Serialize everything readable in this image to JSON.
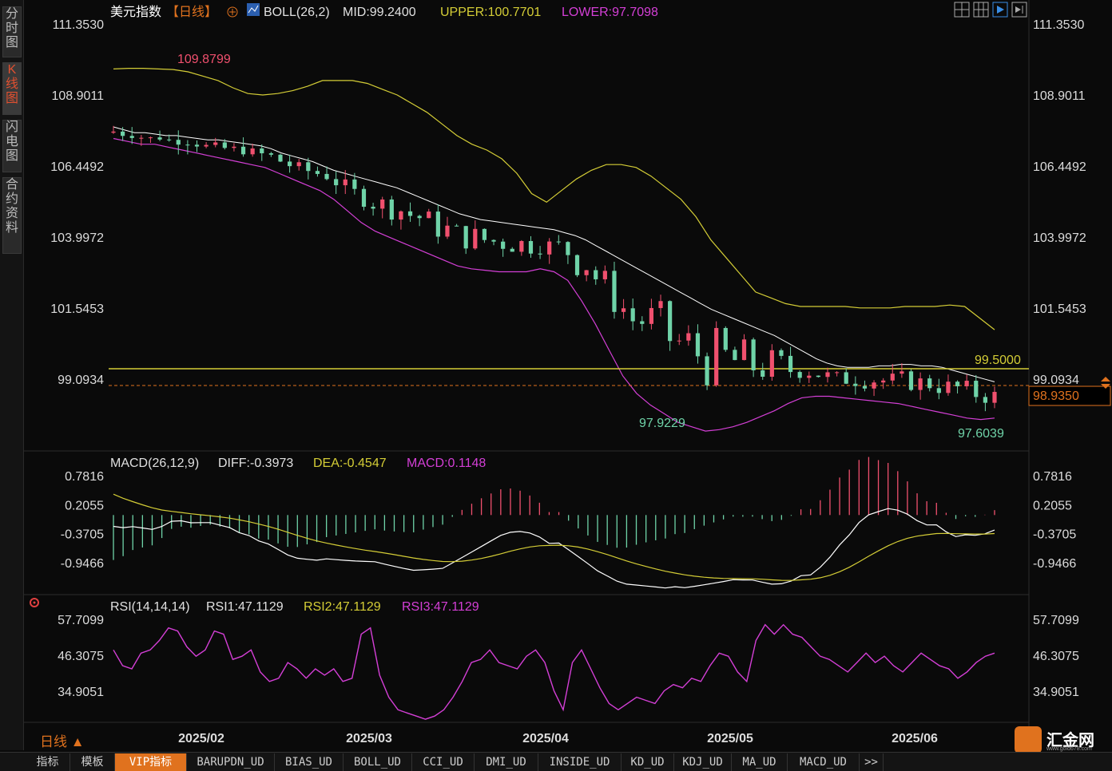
{
  "side_tabs": [
    {
      "label": "分时图",
      "active": false
    },
    {
      "label": "K线图",
      "active": true
    },
    {
      "label": "闪电图",
      "active": false
    },
    {
      "label": "合约资料",
      "active": false
    }
  ],
  "header": {
    "symbol": "美元指数",
    "period_tag": "【日线】",
    "boll": "BOLL(26,2)",
    "mid": "MID:99.2400",
    "upper": "UPPER:100.7701",
    "lower": "LOWER:97.7098"
  },
  "price_axis": [
    "111.3530",
    "108.9011",
    "106.4492",
    "103.9972",
    "101.5453",
    "99.0934"
  ],
  "annotations": {
    "high": "109.8799",
    "low1": "97.9229",
    "low2": "97.6039",
    "hline": "99.5000",
    "current": "98.9350"
  },
  "macd": {
    "title": "MACD(26,12,9)",
    "diff": "DIFF:-0.3973",
    "dea": "DEA:-0.4547",
    "macd": "MACD:0.1148",
    "axis": [
      "0.7816",
      "0.2055",
      "-0.3705",
      "-0.9466"
    ]
  },
  "rsi": {
    "title": "RSI(14,14,14)",
    "rsi1": "RSI1:47.1129",
    "rsi2": "RSI2:47.1129",
    "rsi3": "RSI3:47.1129",
    "axis": [
      "57.7099",
      "46.3075",
      "34.9051"
    ]
  },
  "x_axis": [
    "2025/02",
    "2025/03",
    "2025/04",
    "2025/05",
    "2025/06"
  ],
  "timeframe": "日线",
  "bottom_tabs": [
    "指标",
    "模板",
    "VIP指标",
    "BARUPDN_UD",
    "BIAS_UD",
    "BOLL_UD",
    "CCI_UD",
    "DMI_UD",
    "INSIDE_UD",
    "KD_UD",
    "KDJ_UD",
    "MA_UD",
    "MACD_UD",
    ">>"
  ],
  "logo": {
    "name": "汇金网",
    "url": "www.gold678.com"
  },
  "colors": {
    "up": "#f0506e",
    "down": "#6fd3a8",
    "mid": "#ffffff",
    "upper": "#d4cd36",
    "lower": "#d43fd6",
    "hline": "#d4cd36"
  },
  "chart_data": {
    "type": "candlestick",
    "title": "美元指数",
    "ylim": [
      97.2,
      111.6
    ],
    "start": [
      107.6,
      107.8
    ],
    "series": [
      {
        "name": "MID",
        "values": [
          107.8,
          107.7,
          107.6,
          107.6,
          107.55,
          107.5,
          107.5,
          107.45,
          107.4,
          107.35,
          107.35,
          107.3,
          107.25,
          107.2,
          107.15,
          107.05,
          106.9,
          106.8,
          106.7,
          106.6,
          106.45,
          106.3,
          106.2,
          106.1,
          106.0,
          105.9,
          105.8,
          105.7,
          105.55,
          105.4,
          105.25,
          105.1,
          104.95,
          104.8,
          104.7,
          104.6,
          104.55,
          104.5,
          104.45,
          104.4,
          104.35,
          104.3,
          104.25,
          104.15,
          104.05,
          103.9,
          103.7,
          103.5,
          103.3,
          103.1,
          102.9,
          102.7,
          102.5,
          102.3,
          102.1,
          101.9,
          101.7,
          101.5,
          101.35,
          101.2,
          101.05,
          100.9,
          100.75,
          100.6,
          100.4,
          100.2,
          100.0,
          99.8,
          99.65,
          99.55,
          99.5,
          99.5,
          99.5,
          99.55,
          99.55,
          99.6,
          99.6,
          99.55,
          99.55,
          99.5,
          99.4,
          99.3,
          99.2,
          99.1,
          99.0
        ]
      },
      {
        "name": "UPPER",
        "values": [
          109.8,
          109.82,
          109.82,
          109.8,
          109.78,
          109.7,
          109.55,
          109.4,
          109.15,
          108.95,
          108.9,
          108.95,
          109.05,
          109.2,
          109.4,
          109.4,
          109.4,
          109.3,
          109.1,
          108.9,
          108.6,
          108.3,
          107.9,
          107.5,
          107.2,
          107.0,
          106.7,
          106.2,
          105.5,
          105.2,
          105.6,
          106.0,
          106.3,
          106.5,
          106.5,
          106.4,
          106.1,
          105.7,
          105.3,
          104.7,
          103.9,
          103.3,
          102.7,
          102.1,
          101.9,
          101.7,
          101.6,
          101.6,
          101.6,
          101.6,
          101.55,
          101.55,
          101.55,
          101.6,
          101.6,
          101.6,
          101.65,
          101.6,
          101.2,
          100.8
        ]
      },
      {
        "name": "LOWER",
        "values": [
          107.4,
          107.3,
          107.2,
          107.2,
          107.1,
          107.0,
          106.9,
          106.8,
          106.7,
          106.6,
          106.5,
          106.4,
          106.2,
          106.0,
          105.8,
          105.6,
          105.3,
          104.9,
          104.5,
          104.2,
          104.0,
          103.8,
          103.6,
          103.4,
          103.2,
          103.0,
          102.9,
          102.85,
          102.8,
          102.8,
          102.8,
          102.9,
          102.8,
          102.5,
          101.8,
          101.0,
          100.1,
          99.2,
          98.6,
          98.2,
          97.9,
          97.6,
          97.45,
          97.3,
          97.35,
          97.45,
          97.6,
          97.8,
          98.0,
          98.25,
          98.45,
          98.5,
          98.5,
          98.45,
          98.4,
          98.35,
          98.3,
          98.25,
          98.15,
          98.05,
          97.95,
          97.85,
          97.75,
          97.7,
          97.75
        ]
      },
      {
        "name": "RSI",
        "values": [
          48,
          43,
          42,
          47,
          48,
          51,
          55,
          54,
          49,
          46,
          48,
          54,
          53,
          45,
          46,
          48,
          41,
          38,
          39,
          44,
          42,
          39,
          42,
          40,
          42,
          38,
          39,
          53,
          55,
          40,
          33,
          29,
          28,
          27,
          26,
          27,
          29,
          33,
          38,
          44,
          45,
          48,
          44,
          43,
          42,
          46,
          48,
          44,
          35,
          29,
          44,
          48,
          42,
          36,
          31,
          29,
          31,
          33,
          32,
          31,
          35,
          37,
          36,
          39,
          38,
          43,
          47,
          46,
          41,
          38,
          51,
          56,
          53,
          56,
          53,
          52,
          49,
          46,
          45,
          43,
          41,
          44,
          47,
          44,
          46,
          43,
          41,
          44,
          47,
          45,
          43,
          42,
          39,
          41,
          44,
          46,
          47
        ]
      }
    ]
  }
}
